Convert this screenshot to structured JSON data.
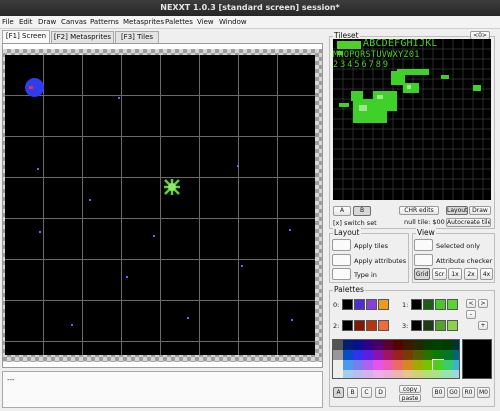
{
  "window": {
    "title": "NEXXT 1.0.3  [standard screen] session*"
  },
  "menu": [
    "File",
    "Edit",
    "Draw",
    "Canvas",
    "Patterns",
    "Metasprites",
    "Palettes",
    "View",
    "Window"
  ],
  "tabs": [
    "[F1] Screen",
    "[F2] Metasprites",
    "[F3] Tiles"
  ],
  "status": {
    "text": "---"
  },
  "tileset": {
    "title": "Tileset",
    "nav_label": "<0>",
    "font_row1": "ABCDEFGHIJKL",
    "font_row2": "MNOPQRSTUVWXYZ01",
    "font_row3": "23456789",
    "bank_a": "A",
    "bank_b": "B",
    "switch_set": "[x] switch set",
    "chr_edits": "CHR edits",
    "null_tile": "null tile: $00",
    "layout": "Layout",
    "draw": "Draw",
    "autocreate": "Autocreate tiles"
  },
  "layout_group": {
    "title": "Layout",
    "apply_tiles": "Apply tiles",
    "apply_attributes": "Apply attributes",
    "type_in": "Type in"
  },
  "view_group": {
    "title": "View",
    "selected_only": "Selected only",
    "attribute_checker": "Attribute checker",
    "grid": "Grid",
    "scr": "Scr",
    "zoom_1x": "1x",
    "zoom_2x": "2x",
    "zoom_4x": "4x"
  },
  "palettes": {
    "title": "Palettes",
    "labels": [
      "0:",
      "1:",
      "2:",
      "3:"
    ],
    "sets": [
      [
        "#000000",
        "#4b2fd0",
        "#8a3ed8",
        "#f09a1c"
      ],
      [
        "#000000",
        "#1a5f12",
        "#49c62a",
        "#5bd23a"
      ],
      [
        "#000000",
        "#7d1a00",
        "#b8350b",
        "#f06a3c"
      ],
      [
        "#000000",
        "#1d3c12",
        "#55a22d",
        "#8bd050"
      ]
    ],
    "arrows": [
      "<",
      ">",
      "-",
      "+"
    ],
    "sub_buttons": [
      "A",
      "B",
      "C",
      "D"
    ],
    "copy": "copy",
    "paste": "paste",
    "bank_buttons": [
      "B0",
      "G0",
      "R0",
      "M0"
    ]
  }
}
